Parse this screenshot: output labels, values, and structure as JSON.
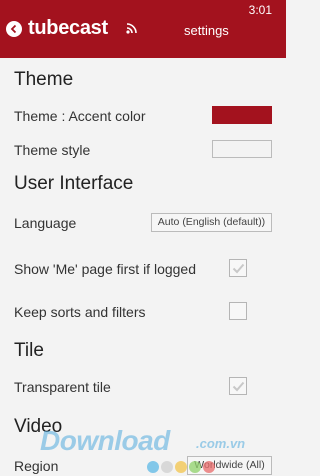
{
  "status_bar": {
    "time": "3:01"
  },
  "header": {
    "app_name": "tubecast",
    "page_title": "settings",
    "back_icon": "back-arrow-icon",
    "rss_icon": "rss-icon",
    "bg_color": "#a3121e"
  },
  "theme": {
    "section_title": "Theme",
    "accent_label": "Theme : Accent color",
    "accent_color": "#a3121e",
    "style_label": "Theme style",
    "style_color": "#f3f3f3"
  },
  "ui": {
    "section_title": "User Interface",
    "language_label": "Language",
    "language_value": "Auto (English (default))",
    "me_page_label": "Show 'Me' page first if logged",
    "me_page_checked": true,
    "keep_sorts_label": "Keep sorts and filters",
    "keep_sorts_checked": false
  },
  "tile": {
    "section_title": "Tile",
    "transparent_label": "Transparent tile",
    "transparent_checked": true
  },
  "video": {
    "section_title": "Video",
    "region_label": "Region",
    "region_value": "Worldwide (All)"
  },
  "watermark": {
    "text": "Download",
    "tld": ".com.vn",
    "dot_colors": [
      "#5cb8e6",
      "#cfcfcf",
      "#f3c44b",
      "#8fd16a",
      "#e86a6a"
    ]
  }
}
